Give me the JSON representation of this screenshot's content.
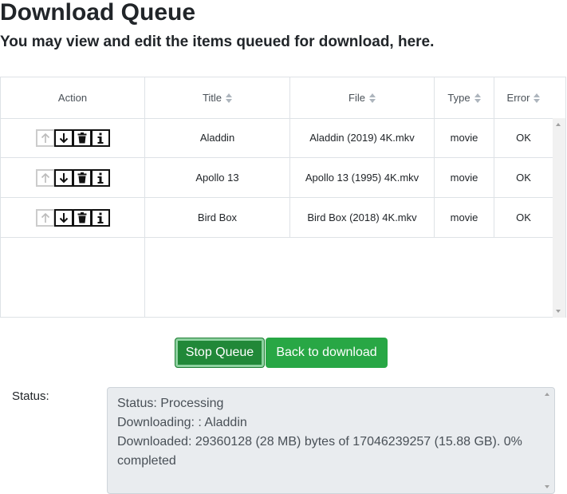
{
  "page": {
    "title": "Download Queue",
    "subtitle": "You may view and edit the items queued for download, here."
  },
  "table": {
    "headers": {
      "action": "Action",
      "title": "Title",
      "file": "File",
      "type": "Type",
      "error": "Error"
    },
    "rows": [
      {
        "title": "Aladdin",
        "file": "Aladdin (2019) 4K.mkv",
        "type": "movie",
        "error": "OK"
      },
      {
        "title": "Apollo 13",
        "file": "Apollo 13 (1995) 4K.mkv",
        "type": "movie",
        "error": "OK"
      },
      {
        "title": "Bird Box",
        "file": "Bird Box (2018) 4K.mkv",
        "type": "movie",
        "error": "OK"
      }
    ],
    "row_action_icons": [
      "arrow-up-icon",
      "arrow-down-icon",
      "trash-icon",
      "info-icon"
    ]
  },
  "buttons": {
    "stop_queue": "Stop Queue",
    "back_to_download": "Back to download"
  },
  "status": {
    "label": "Status:",
    "lines": [
      "Status: Processing",
      "Downloading: : Aladdin",
      "Downloaded: 29360128 (28 MB) bytes of 17046239257 (15.88 GB). 0% completed"
    ]
  },
  "colors": {
    "primary_green": "#28a745",
    "active_green": "#218838",
    "status_bg": "#e9ecef"
  }
}
